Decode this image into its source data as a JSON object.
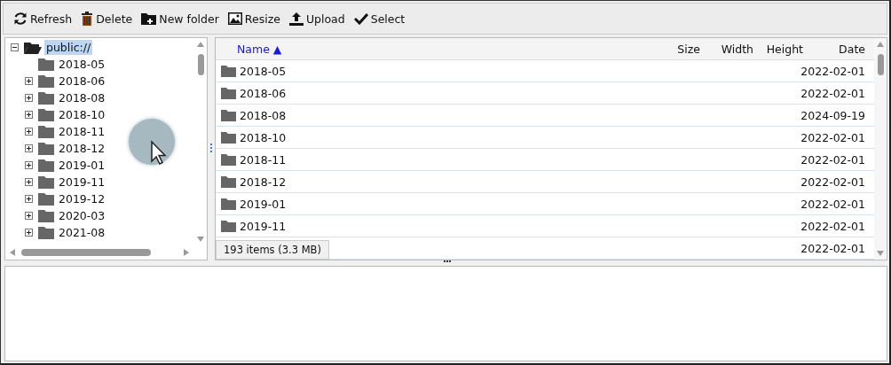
{
  "toolbar": [
    {
      "kind": "refresh",
      "label": "Refresh"
    },
    {
      "kind": "delete",
      "label": "Delete"
    },
    {
      "kind": "newfolder",
      "label": "New folder"
    },
    {
      "kind": "resize",
      "label": "Resize"
    },
    {
      "kind": "upload",
      "label": "Upload"
    },
    {
      "kind": "select",
      "label": "Select"
    }
  ],
  "tree": {
    "label": "public://",
    "expanded": true,
    "selected": true,
    "children": [
      {
        "label": "2018-05",
        "expandable": false
      },
      {
        "label": "2018-06",
        "expandable": true
      },
      {
        "label": "2018-08",
        "expandable": true
      },
      {
        "label": "2018-10",
        "expandable": true
      },
      {
        "label": "2018-11",
        "expandable": true
      },
      {
        "label": "2018-12",
        "expandable": true
      },
      {
        "label": "2019-01",
        "expandable": true
      },
      {
        "label": "2019-11",
        "expandable": true
      },
      {
        "label": "2019-12",
        "expandable": true
      },
      {
        "label": "2020-03",
        "expandable": true
      },
      {
        "label": "2021-08",
        "expandable": true
      }
    ]
  },
  "table": {
    "columns": [
      {
        "label": "Name ▲",
        "sorted": true
      },
      {
        "label": "Size",
        "sorted": false
      },
      {
        "label": "Width",
        "sorted": false
      },
      {
        "label": "Height",
        "sorted": false
      },
      {
        "label": "Date",
        "sorted": false
      }
    ],
    "rows": [
      {
        "name": "2018-05",
        "date": "2022-02-01"
      },
      {
        "name": "2018-06",
        "date": "2022-02-01"
      },
      {
        "name": "2018-08",
        "date": "2024-09-19"
      },
      {
        "name": "2018-10",
        "date": "2022-02-01"
      },
      {
        "name": "2018-11",
        "date": "2022-02-01"
      },
      {
        "name": "2018-12",
        "date": "2022-02-01"
      },
      {
        "name": "2019-01",
        "date": "2022-02-01"
      },
      {
        "name": "2019-11",
        "date": "2022-02-01"
      },
      {
        "date": "2022-02-01"
      }
    ]
  },
  "status": "193 items (3.3 MB)"
}
